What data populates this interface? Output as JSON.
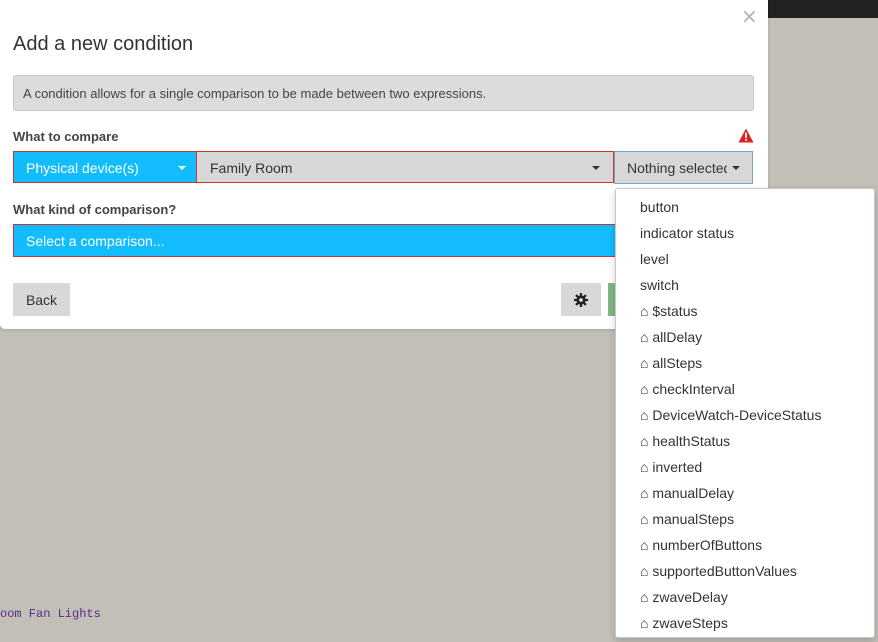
{
  "background": {
    "text": "oom Fan Lights"
  },
  "modal": {
    "close_glyph": "×",
    "title": "Add a new condition",
    "info": "A condition allows for a single comparison to be made between two expressions.",
    "what_to_compare_label": "What to compare",
    "device_button": "Physical device(s)",
    "device_select": "Family Room",
    "attribute_select": "Nothing selected",
    "comparison_label": "What kind of comparison?",
    "comparison_select": "Select a comparison...",
    "back_button": "Back",
    "settings_icon": "gear-icon",
    "warning_icon": "warning-triangle-icon"
  },
  "colors": {
    "accent": "#13bdfd",
    "error_border": "#cc3333",
    "warning": "#e02020",
    "ok_button": "#7fb884"
  },
  "dropdown": {
    "items": [
      "button",
      "indicator status",
      "level",
      "switch",
      "⌂ $status",
      "⌂ allDelay",
      "⌂ allSteps",
      "⌂ checkInterval",
      "⌂ DeviceWatch-DeviceStatus",
      "⌂ healthStatus",
      "⌂ inverted",
      "⌂ manualDelay",
      "⌂ manualSteps",
      "⌂ numberOfButtons",
      "⌂ supportedButtonValues",
      "⌂ zwaveDelay",
      "⌂ zwaveSteps"
    ]
  }
}
